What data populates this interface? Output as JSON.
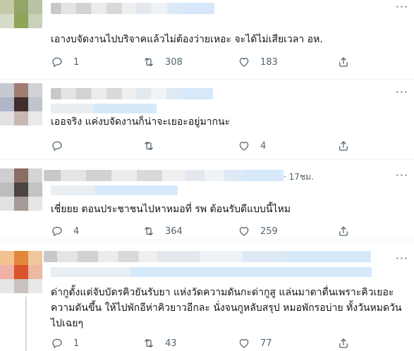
{
  "tweets": [
    {
      "text": "เอางบจัดงานไปบริจาคแล้วไม่ต้องว่ายเหอะ จะได้ไม่เสียเวลา อห.",
      "reply_count": "1",
      "retweet_count": "308",
      "like_count": "183",
      "timestamp": ""
    },
    {
      "text": "เออจริง แค่งบจัดงานก็น่าจะเยอะอยู่มากนะ",
      "reply_count": "",
      "retweet_count": "",
      "like_count": "4",
      "timestamp": ""
    },
    {
      "text": "เชี่ยยย ตอนประชาชนไปหาหมอที่ รพ ต้อนรับดีแบบนี้ไหม",
      "reply_count": "4",
      "retweet_count": "364",
      "like_count": "259",
      "timestamp": "· 17ชม."
    },
    {
      "text": "ด่ากูตั้งแต่จับบัตรคิวยันรับยา แห่งวัดความดันกะด่ากูสู แล่นมาตาตื่นเพราะคิวเยอะความดันขึ้น ให้ไปพักอีห่าคิวยาวอีกละ นั่งจนกูหลับสรุป หมอพักรอบ่าย ทั้งวันหมดวันไปเฉยๆ",
      "reply_count": "1",
      "retweet_count": "43",
      "like_count": "77",
      "timestamp": ""
    }
  ],
  "icons": {
    "reply": "reply-icon",
    "retweet": "retweet-icon",
    "like": "heart-icon",
    "share": "share-icon",
    "more": "more-icon"
  },
  "more_glyph": "···"
}
